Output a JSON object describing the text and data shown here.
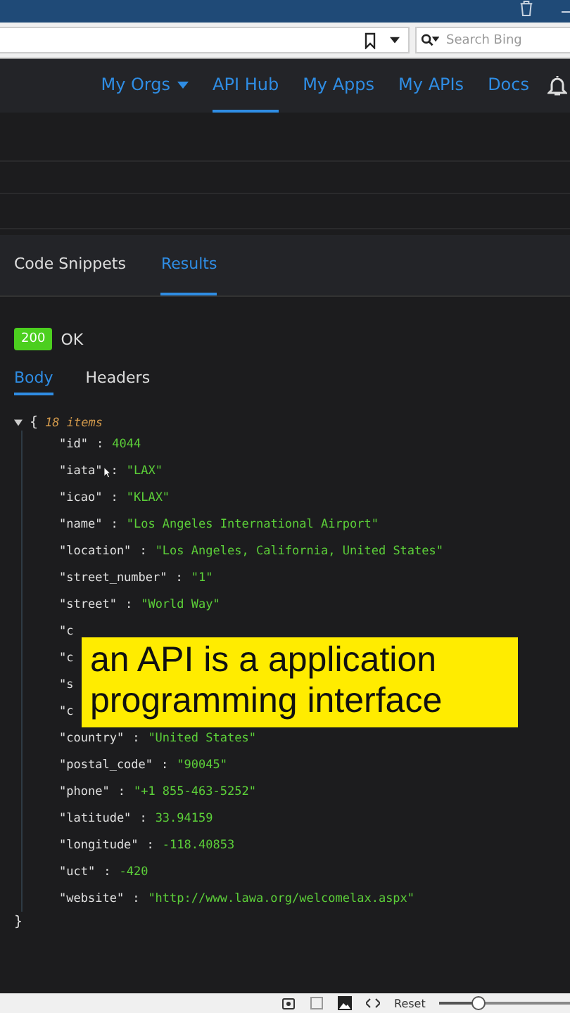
{
  "browser": {
    "search": {
      "placeholder": "Search Bing"
    }
  },
  "nav": {
    "items": [
      {
        "label": "My Orgs",
        "dropdown": true,
        "selected": false
      },
      {
        "label": "API Hub",
        "dropdown": false,
        "selected": true
      },
      {
        "label": "My Apps",
        "dropdown": false,
        "selected": false
      },
      {
        "label": "My APIs",
        "dropdown": false,
        "selected": false
      },
      {
        "label": "Docs",
        "dropdown": false,
        "selected": false
      }
    ]
  },
  "result_tabs": [
    {
      "label": "Code Snippets",
      "selected": false
    },
    {
      "label": "Results",
      "selected": true
    }
  ],
  "status": {
    "code": "200",
    "text": "OK"
  },
  "body_tabs": [
    {
      "label": "Body",
      "selected": true
    },
    {
      "label": "Headers",
      "selected": false
    }
  ],
  "json_view": {
    "expanded": true,
    "open_brace": "{",
    "count": "18 items",
    "close_brace": "}",
    "rows": [
      {
        "key": "\"id\"",
        "sep": ":",
        "value": "4044"
      },
      {
        "key": "\"iata\"",
        "sep": ":",
        "value": "\"LAX\""
      },
      {
        "key": "\"icao\"",
        "sep": ":",
        "value": "\"KLAX\""
      },
      {
        "key": "\"name\"",
        "sep": ":",
        "value": "\"Los Angeles International Airport\""
      },
      {
        "key": "\"location\"",
        "sep": ":",
        "value": "\"Los Angeles, California, United States\""
      },
      {
        "key": "\"street_number\"",
        "sep": ":",
        "value": "\"1\""
      },
      {
        "key": "\"street\"",
        "sep": ":",
        "value": "\"World Way\""
      },
      {
        "key": "\"c"
      },
      {
        "key": "\"c"
      },
      {
        "key": "\"s"
      },
      {
        "key": "\"c"
      },
      {
        "key": "\"country\"",
        "sep": ":",
        "value": "\"United States\""
      },
      {
        "key": "\"postal_code\"",
        "sep": ":",
        "value": "\"90045\""
      },
      {
        "key": "\"phone\"",
        "sep": ":",
        "value": "\"+1 855-463-5252\""
      },
      {
        "key": "\"latitude\"",
        "sep": ":",
        "value": "33.94159"
      },
      {
        "key": "\"longitude\"",
        "sep": ":",
        "value": "-118.40853"
      },
      {
        "key": "\"uct\"",
        "sep": ":",
        "value": "-420"
      },
      {
        "key": "\"website\"",
        "sep": ":",
        "value": "\"http://www.lawa.org/welcomelax.aspx\""
      }
    ]
  },
  "caption": {
    "lines": [
      "an API is a application",
      "programming interface"
    ]
  },
  "bottom_bar": {
    "reset": "Reset",
    "zoom": {
      "level": 0.3
    }
  }
}
